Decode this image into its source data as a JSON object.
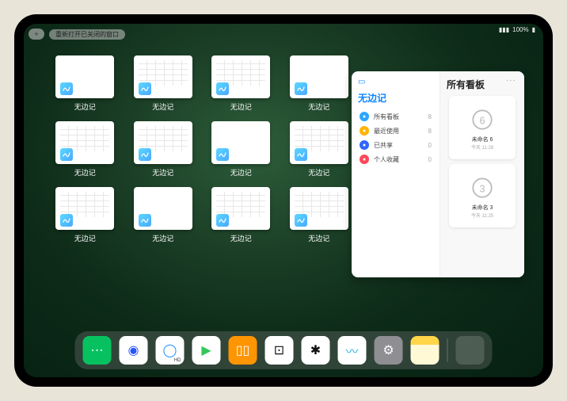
{
  "status": {
    "signal": "▮▮▮",
    "percent": "100%",
    "battery": "▮"
  },
  "topbar": {
    "plus": "+",
    "pill": "重新打开已关闭的窗口"
  },
  "app_label": "无边记",
  "windows": [
    {
      "variant": "blank"
    },
    {
      "variant": "grid"
    },
    {
      "variant": "grid"
    },
    {
      "variant": "blank"
    },
    {
      "variant": "grid"
    },
    {
      "variant": "grid"
    },
    {
      "variant": "blank"
    },
    {
      "variant": "grid"
    },
    {
      "variant": "grid"
    },
    {
      "variant": "blank"
    },
    {
      "variant": "grid"
    },
    {
      "variant": "grid"
    }
  ],
  "panel": {
    "more": "···",
    "left_title": "无边记",
    "right_title": "所有看板",
    "sidebar": [
      {
        "label": "所有看板",
        "count": "8",
        "color": "#2aa6ff"
      },
      {
        "label": "最近使用",
        "count": "8",
        "color": "#ffb300"
      },
      {
        "label": "已共享",
        "count": "0",
        "color": "#3066ff"
      },
      {
        "label": "个人收藏",
        "count": "0",
        "color": "#ff4757"
      }
    ],
    "boards": [
      {
        "name": "未命名 6",
        "sub": "今天 11:28",
        "digit": "6"
      },
      {
        "name": "未命名 3",
        "sub": "今天 11:25",
        "digit": "3"
      }
    ]
  },
  "dock": [
    {
      "name": "wechat",
      "bg": "#07c160",
      "glyph": "⋯"
    },
    {
      "name": "browser-1",
      "bg": "#ffffff",
      "glyph": "◉",
      "fg": "#2755ff"
    },
    {
      "name": "browser-2",
      "bg": "#ffffff",
      "glyph": "◯",
      "fg": "#1e90ff",
      "hd": "HD"
    },
    {
      "name": "media",
      "bg": "#ffffff",
      "glyph": "▶",
      "fg": "#34c759"
    },
    {
      "name": "books",
      "bg": "#ff9500",
      "glyph": "▯▯"
    },
    {
      "name": "dice",
      "bg": "#ffffff",
      "glyph": "⊡",
      "fg": "#111"
    },
    {
      "name": "graph",
      "bg": "#ffffff",
      "glyph": "✱",
      "fg": "#111"
    },
    {
      "name": "freeform",
      "bg": "#ffffff",
      "glyph": "〰",
      "fg": "#23b6ec"
    },
    {
      "name": "settings",
      "bg": "#8e8e93",
      "glyph": "⚙"
    },
    {
      "name": "notes",
      "bg": "#fff9d6",
      "glyph": "",
      "topbar": "#ffd54a"
    },
    {
      "name": "app-library",
      "bg": "quad"
    }
  ]
}
